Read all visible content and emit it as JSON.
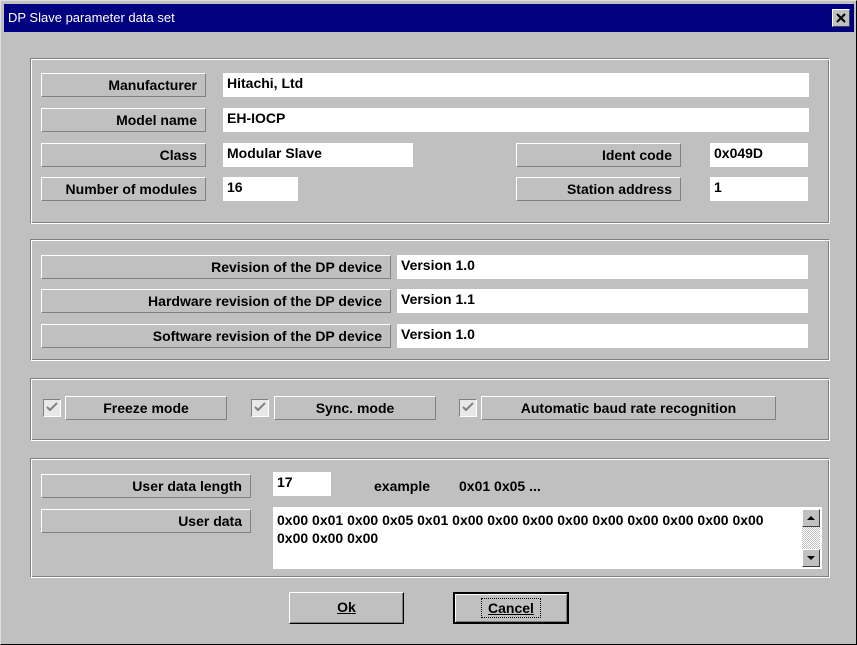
{
  "window": {
    "title": "DP Slave parameter data set"
  },
  "device": {
    "manufacturer_label": "Manufacturer",
    "manufacturer_value": "Hitachi, Ltd",
    "model_label": "Model name",
    "model_value": "EH-IOCP",
    "class_label": "Class",
    "class_value": "Modular Slave",
    "ident_label": "Ident code",
    "ident_value": "0x049D",
    "modules_label": "Number of modules",
    "modules_value": "16",
    "station_label": "Station address",
    "station_value": "1"
  },
  "revisions": {
    "dp_label": "Revision of the DP device",
    "dp_value": "Version 1.0",
    "hw_label": "Hardware revision of the DP device",
    "hw_value": "Version 1.1",
    "sw_label": "Software revision of the DP device",
    "sw_value": "Version 1.0"
  },
  "modes": {
    "freeze_label": "Freeze mode",
    "freeze_checked": true,
    "sync_label": "Sync. mode",
    "sync_checked": true,
    "baud_label": "Automatic baud rate recognition",
    "baud_checked": true
  },
  "user_data": {
    "length_label": "User data length",
    "length_value": "17",
    "example_label": "example",
    "example_value": "0x01 0x05 ...",
    "data_label": "User data",
    "data_value": "0x00 0x01 0x00 0x05 0x01 0x00 0x00 0x00 0x00 0x00 0x00 0x00 0x00 0x00 0x00 0x00 0x00"
  },
  "buttons": {
    "ok_label": "Ok",
    "cancel_label": "Cancel"
  },
  "colors": {
    "titlebar": "#000080",
    "dialog": "#c0c0c0",
    "field": "#ffffff"
  }
}
